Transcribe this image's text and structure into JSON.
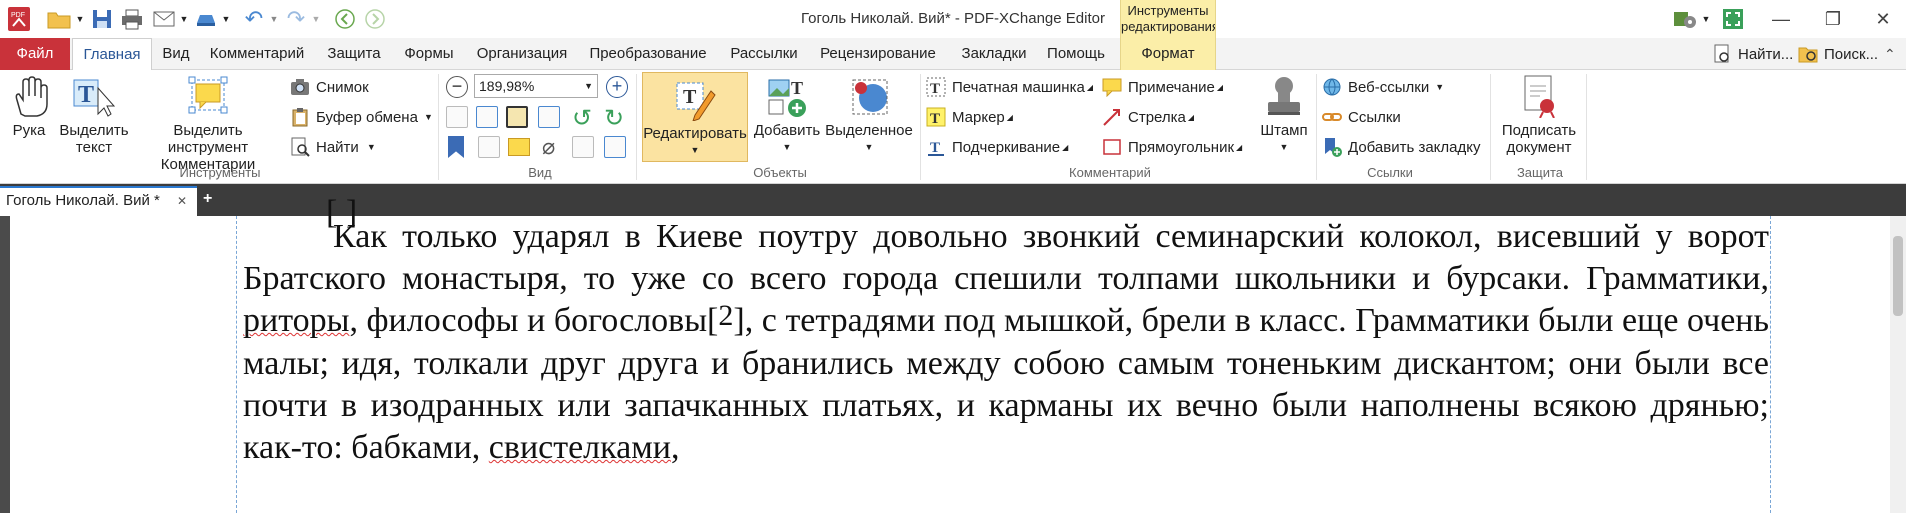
{
  "window": {
    "title": "Гоголь Николай. Вий* - PDF-XChange Editor",
    "context_group": "Инструменты редактирования"
  },
  "tabs": [
    "Файл",
    "Главная",
    "Вид",
    "Комментарий",
    "Защита",
    "Формы",
    "Организация",
    "Преобразование",
    "Рассылки",
    "Рецензирование",
    "Закладки",
    "Помощь",
    "Формат"
  ],
  "right_tools": {
    "find": "Найти...",
    "search": "Поиск..."
  },
  "ribbon": {
    "tools": {
      "hand": "Рука",
      "select_text": "Выделить\nтекст",
      "select_comment": "Выделить инструмент\nКомментарии",
      "snapshot": "Снимок",
      "clipboard": "Буфер обмена",
      "find": "Найти",
      "label": "Инструменты"
    },
    "view": {
      "zoom": "189,98%",
      "label": "Вид"
    },
    "objects": {
      "edit": "Редактировать",
      "add": "Добавить",
      "selected": "Выделенное",
      "label": "Объекты"
    },
    "comments": {
      "typewriter": "Печатная машинка",
      "note": "Примечание",
      "highlight": "Маркер",
      "arrow": "Стрелка",
      "underline": "Подчеркивание",
      "rectangle": "Прямоугольник",
      "stamp": "Штамп",
      "label": "Комментарий"
    },
    "links": {
      "web": "Веб-ссылки",
      "links": "Ссылки",
      "bookmark": "Добавить закладку",
      "label": "Ссылки"
    },
    "protect": {
      "sign": "Подписать\nдокумент",
      "label": "Защита"
    }
  },
  "doc_tab": "Гоголь Николай. Вий *",
  "body": {
    "top_fragment": "[ ]",
    "p1_a": "Как только ударял в Киеве поутру довольно звонкий семинарский колокол, висевший у ворот Братского монастыря, то уже со всего города спешили толпами школьники и бурсаки. Грамматики, ",
    "p1_sq1": "риторы",
    "p1_b": ", философы и богословы[",
    "p1_fn": "2",
    "p1_c": "], с тетрадями под мышкой, брели в класс. Грамматики были еще очень малы; идя, толкали друг друга и бранились между собою самым тоненьким дискантом; они были все почти в изодранных или запачканных платьях, и карманы их вечно были наполнены всякою дрянью; как-то: бабками, ",
    "p1_sq2": "свистелками",
    "p1_d": ","
  },
  "colors": {
    "file_tab": "#c9323a",
    "accent": "#2b5797",
    "context": "#fbeea8"
  }
}
